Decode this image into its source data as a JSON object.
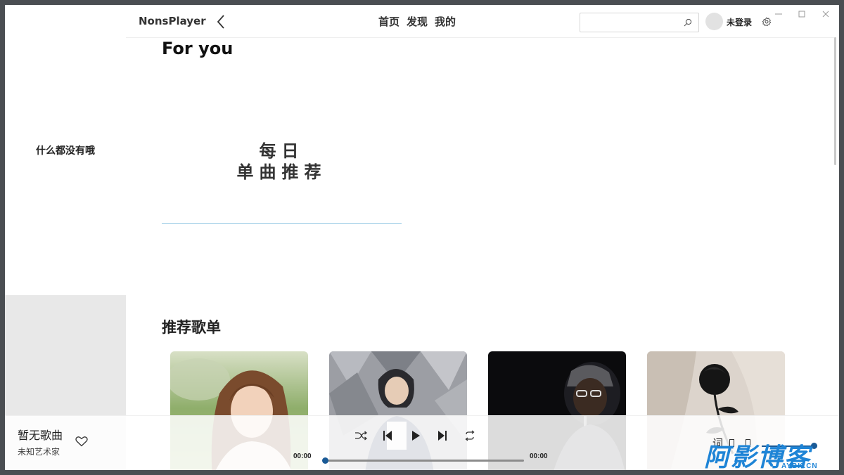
{
  "app": {
    "name": "NonsPlayer"
  },
  "nav": {
    "items": [
      "首页",
      "发现",
      "我的"
    ]
  },
  "search": {
    "placeholder": "",
    "value": ""
  },
  "user": {
    "login_label": "未登录"
  },
  "sidebar": {
    "empty_text": "什么都没有哦"
  },
  "main": {
    "for_you_title": "For you",
    "daily": {
      "line1": "每日",
      "line2": "单曲推荐"
    },
    "playlists_title": "推荐歌单",
    "playlists": [
      {
        "icon": "cover-woman-outdoor"
      },
      {
        "icon": "cover-woman-sitting"
      },
      {
        "icon": "cover-man-singing"
      },
      {
        "icon": "cover-rose-hand"
      }
    ]
  },
  "player": {
    "song_title": "暂无歌曲",
    "artist": "未知艺术家",
    "time_current": "00:00",
    "time_total": "00:00",
    "progress": 0,
    "lyric_label": "词",
    "volume": 1.0,
    "controls": [
      "shuffle-icon",
      "previous-icon",
      "play-icon",
      "next-icon",
      "repeat-icon"
    ]
  },
  "watermark": {
    "main": "阿影博客",
    "sub": "AYBK.CN"
  },
  "colors": {
    "accent": "#1a5a96",
    "sidebar_gray": "#e8e8e8",
    "daily_underline": "#8fc6e3",
    "watermark": "#1e84d6"
  }
}
